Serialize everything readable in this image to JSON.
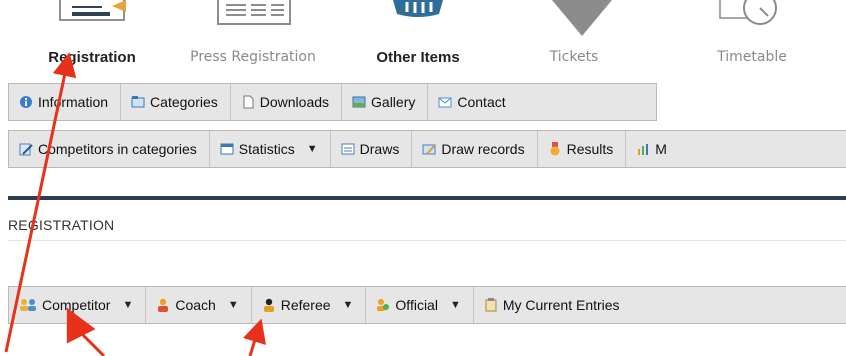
{
  "topnav": {
    "items": [
      {
        "label": "Registration",
        "icon": "registration-icon",
        "state": "active"
      },
      {
        "label": "Press Registration",
        "icon": "press-registration-icon",
        "state": "dim"
      },
      {
        "label": "Other Items",
        "icon": "basket-icon",
        "state": "active"
      },
      {
        "label": "Tickets",
        "icon": "ticket-icon",
        "state": "dim"
      },
      {
        "label": "Timetable",
        "icon": "clock-icon",
        "state": "dim"
      }
    ]
  },
  "toolbar1": {
    "items": [
      {
        "label": "Information",
        "icon": "info-icon"
      },
      {
        "label": "Categories",
        "icon": "folder-icon"
      },
      {
        "label": "Downloads",
        "icon": "document-icon"
      },
      {
        "label": "Gallery",
        "icon": "image-icon"
      },
      {
        "label": "Contact",
        "icon": "mail-icon"
      }
    ]
  },
  "toolbar2": {
    "items": [
      {
        "label": "Competitors in categories",
        "icon": "edit-icon"
      },
      {
        "label": "Statistics",
        "icon": "table-icon",
        "dropdown": true
      },
      {
        "label": "Draws",
        "icon": "list-icon"
      },
      {
        "label": "Draw records",
        "icon": "records-icon"
      },
      {
        "label": "Results",
        "icon": "medal-icon"
      },
      {
        "label": "M",
        "icon": "chart-icon"
      }
    ]
  },
  "section": {
    "title": "REGISTRATION"
  },
  "toolbar3": {
    "items": [
      {
        "label": "Competitor",
        "icon": "group-icon",
        "dropdown": true
      },
      {
        "label": "Coach",
        "icon": "person-orange-icon",
        "dropdown": true
      },
      {
        "label": "Referee",
        "icon": "person-dark-icon",
        "dropdown": true
      },
      {
        "label": "Official",
        "icon": "person-group-icon",
        "dropdown": true
      },
      {
        "label": "My Current Entries",
        "icon": "clipboard-icon"
      }
    ]
  },
  "colors": {
    "annotation_arrow": "#e8311a",
    "header_bar": "#2c3e50",
    "toolbar_bg": "#e6e6e6"
  }
}
